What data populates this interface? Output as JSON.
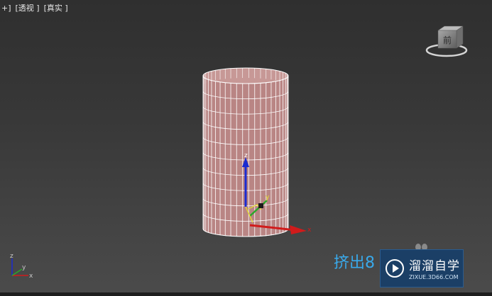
{
  "viewport": {
    "labels": [
      "+]",
      "[透视 ]",
      "[真实 ]"
    ]
  },
  "viewcube": {
    "face_label": "前"
  },
  "gizmo": {
    "axis_labels": {
      "x": "x",
      "y": "y",
      "z": "z"
    }
  },
  "corner_axis": {
    "labels": {
      "x": "x",
      "y": "y",
      "z": "z"
    }
  },
  "watermark": {
    "caption": "挤出8",
    "logo_name": "溜溜自学",
    "logo_url": "ZIXUE.3D66.COM"
  },
  "colors": {
    "mesh_fill": "#b98584",
    "wire": "#ffffff",
    "axis_x": "#d11b1b",
    "axis_y": "#2aa82a",
    "axis_z": "#1b2bd1",
    "gizmo_yellow": "#e7e327",
    "caption_blue": "#39a9ea",
    "logo_bg": "#1b3f66"
  }
}
